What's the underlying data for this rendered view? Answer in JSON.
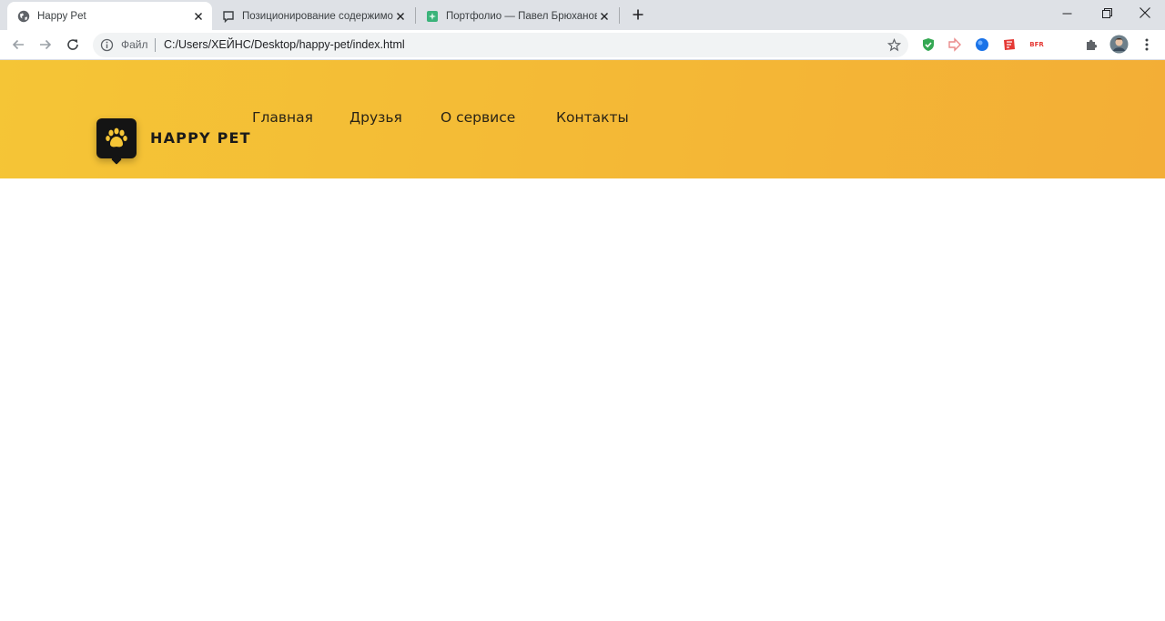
{
  "browser": {
    "tabs": [
      {
        "title": "Happy Pet",
        "icon": "globe-icon",
        "active": true
      },
      {
        "title": "Позиционирование содержимого",
        "icon": "chat-icon",
        "active": false
      },
      {
        "title": "Портфолио — Павел Брюханов",
        "icon": "green-square-icon",
        "active": false
      }
    ],
    "omnibox": {
      "site_label": "Файл",
      "url": "C:/Users/ХЕЙНС/Desktop/happy-pet/index.html"
    },
    "extensions": [
      "shield-icon",
      "arrow-ext-icon",
      "blue-circle-icon",
      "red-ext-icon",
      "text-ext-icon",
      "puzzle-icon",
      "avatar",
      "kebab-menu-icon"
    ],
    "ext_text": "BFR"
  },
  "site": {
    "brand": "HAPPY PET",
    "nav": [
      "Главная",
      "Друзья",
      "О сервисе",
      "Контакты"
    ],
    "colors": {
      "header_start": "#f5c536",
      "header_end": "#f3ae36",
      "logo_bg": "#141414",
      "paw": "#f5c536"
    }
  }
}
